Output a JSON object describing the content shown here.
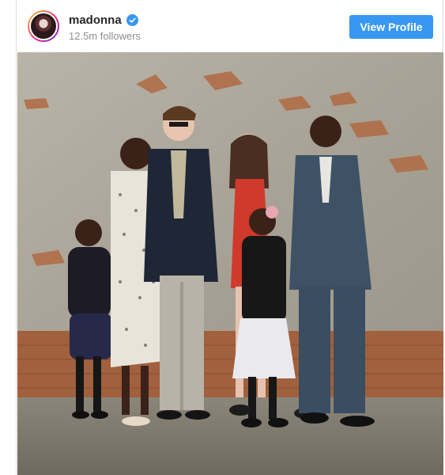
{
  "post": {
    "username": "madonna",
    "followers": "12.5m followers",
    "view_profile_label": "View Profile"
  },
  "icons": {
    "verified": "verified-badge-icon",
    "avatar": "profile-avatar"
  },
  "colors": {
    "accent": "#3897f0",
    "username": "#262626",
    "secondary_text": "#8e8e8e"
  }
}
